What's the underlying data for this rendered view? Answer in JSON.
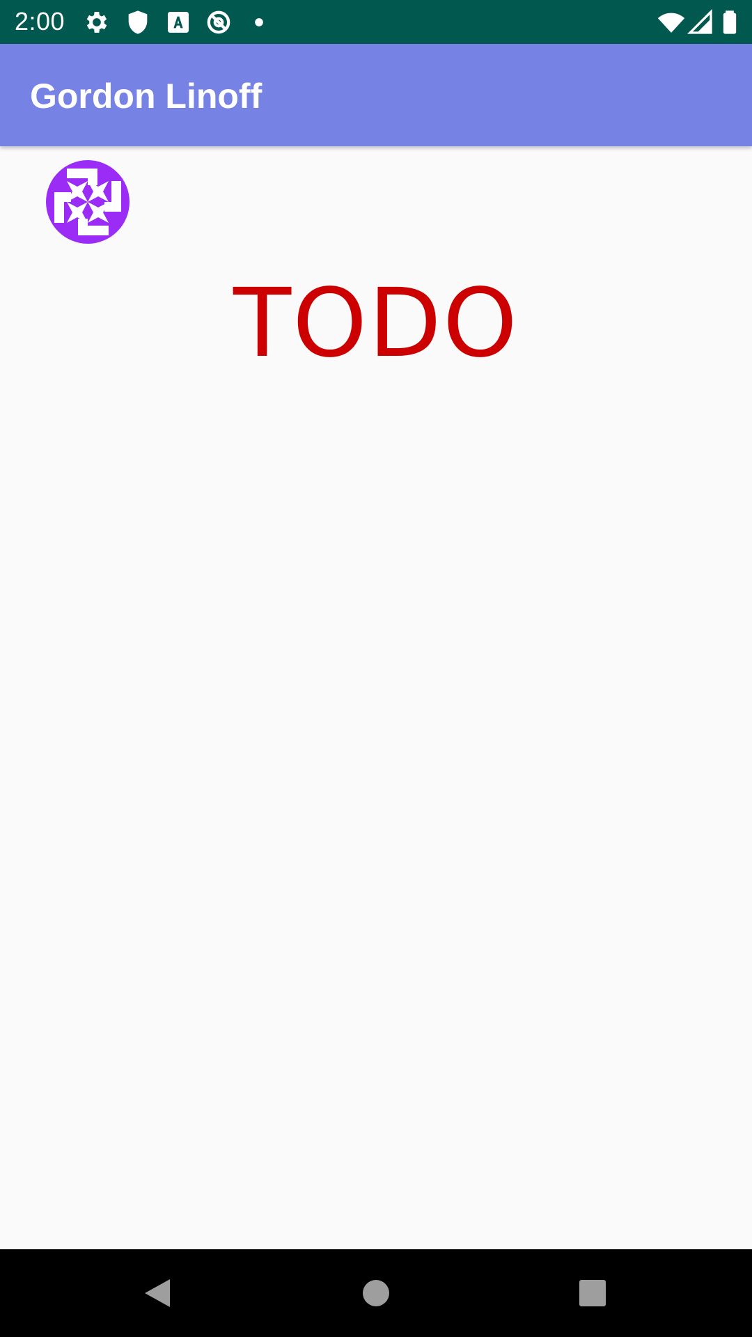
{
  "status_bar": {
    "time": "2:00",
    "background": "#00584f",
    "icons": [
      "gear-icon",
      "shield-icon",
      "font-a-icon",
      "no-disturb-icon",
      "dot-icon",
      "wifi-icon",
      "signal-icon",
      "battery-icon"
    ]
  },
  "app_bar": {
    "title": "Gordon Linoff",
    "background": "#7683e5"
  },
  "main": {
    "avatar_icon": "identicon-avatar",
    "avatar_color": "#9b2cf5",
    "todo_label": "TODO",
    "todo_color": "#cc0000"
  },
  "nav_bar": {
    "buttons": [
      "back-icon",
      "home-icon",
      "recents-icon"
    ]
  }
}
